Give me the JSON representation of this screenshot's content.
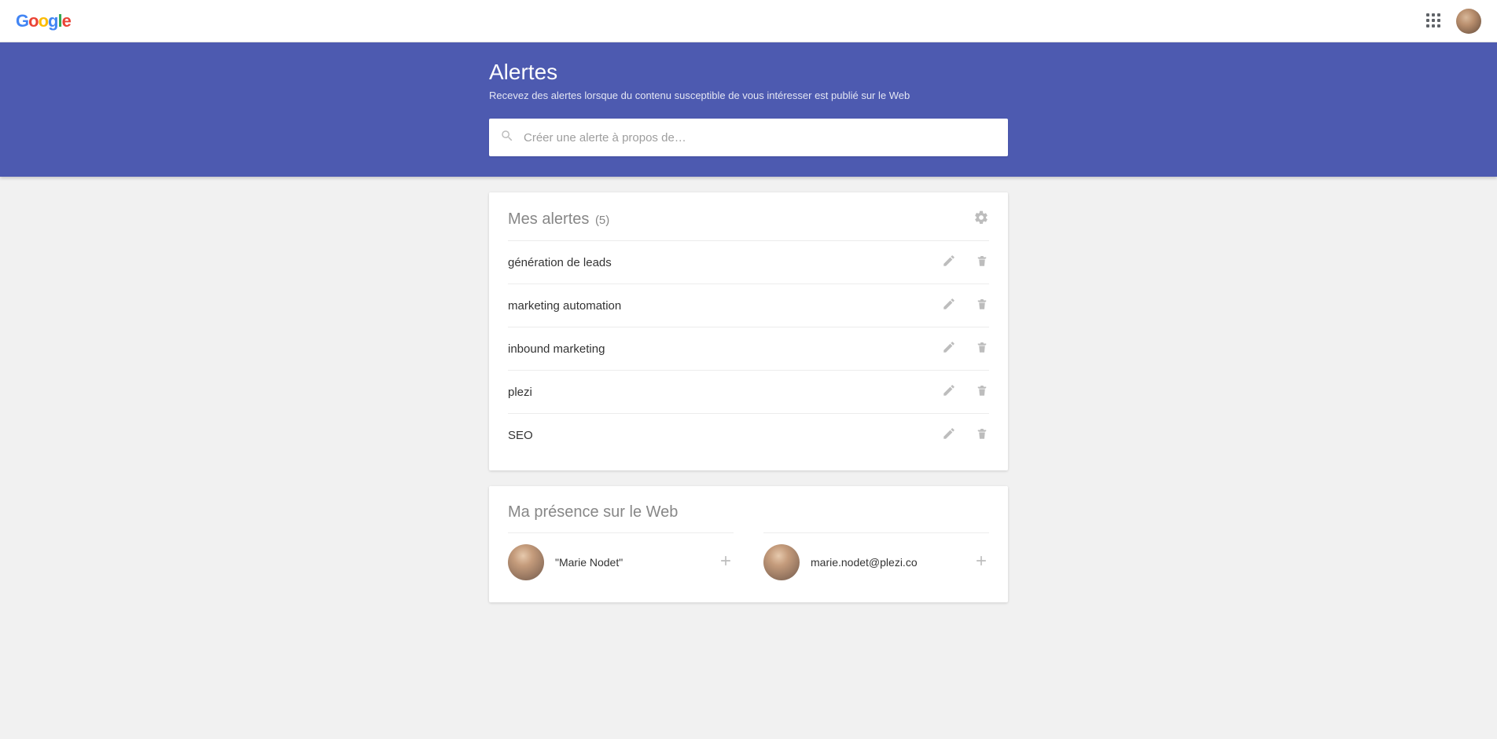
{
  "topbar": {
    "logo_letters": [
      "G",
      "o",
      "o",
      "g",
      "l",
      "e"
    ]
  },
  "hero": {
    "title": "Alertes",
    "subtitle": "Recevez des alertes lorsque du contenu susceptible de vous intéresser est publié sur le Web",
    "search_placeholder": "Créer une alerte à propos de…"
  },
  "my_alerts": {
    "title": "Mes alertes",
    "count_display": "(5)",
    "items": [
      {
        "label": "génération de leads"
      },
      {
        "label": "marketing automation"
      },
      {
        "label": "inbound marketing"
      },
      {
        "label": "plezi"
      },
      {
        "label": "SEO"
      }
    ]
  },
  "presence": {
    "title": "Ma présence sur le Web",
    "items": [
      {
        "label": "\"Marie Nodet\""
      },
      {
        "label": "marie.nodet@plezi.co"
      }
    ]
  }
}
